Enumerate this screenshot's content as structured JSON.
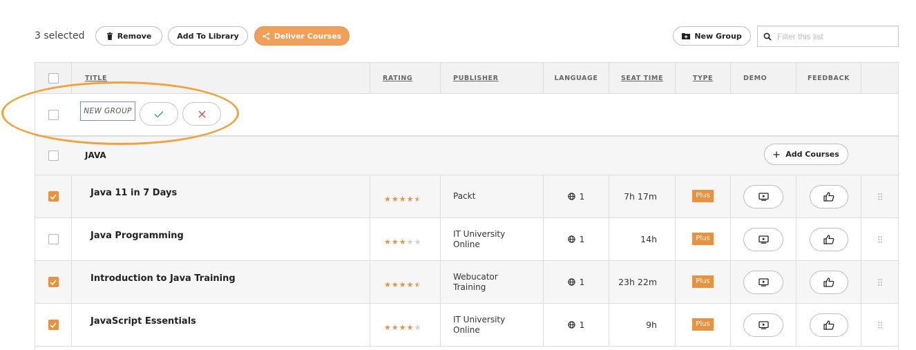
{
  "toolbar": {
    "selected_text": "3 selected",
    "remove_label": "Remove",
    "add_library_label": "Add To Library",
    "deliver_label": "Deliver Courses",
    "new_group_label": "New Group",
    "filter_placeholder": "Filter this list"
  },
  "columns": {
    "title": "TITLE",
    "rating": "RATING",
    "publisher": "PUBLISHER",
    "language": "LANGUAGE",
    "seat_time": "SEAT TIME",
    "type": "TYPE",
    "demo": "DEMO",
    "feedback": "FEEDBACK"
  },
  "new_group": {
    "input_value": "NEW GROUP"
  },
  "group": {
    "title": "JAVA",
    "add_courses_label": "Add Courses"
  },
  "colors": {
    "accent": "#e8913e",
    "star_on": "#e8913e",
    "star_off": "#cfcfcf",
    "confirm": "#2fae62",
    "cancel": "#e04848"
  },
  "courses": [
    {
      "title": "Java 11 in 7 Days",
      "rating": 4.5,
      "publisher_line1": "Packt",
      "publisher_line2": "",
      "languages": "1",
      "seat_time": "7h 17m",
      "type": "Plus",
      "selected": true
    },
    {
      "title": "Java Programming",
      "rating": 3,
      "publisher_line1": "IT University",
      "publisher_line2": "Online",
      "languages": "1",
      "seat_time": "14h",
      "type": "Plus",
      "selected": false
    },
    {
      "title": "Introduction to Java Training",
      "rating": 4.5,
      "publisher_line1": "Webucator",
      "publisher_line2": "Training",
      "languages": "1",
      "seat_time": "23h 22m",
      "type": "Plus",
      "selected": true
    },
    {
      "title": "JavaScript Essentials",
      "rating": 4,
      "publisher_line1": "IT University",
      "publisher_line2": "Online",
      "languages": "1",
      "seat_time": "9h",
      "type": "Plus",
      "selected": true
    }
  ]
}
